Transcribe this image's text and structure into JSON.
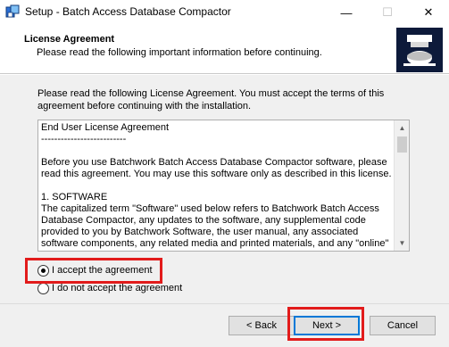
{
  "window": {
    "title": "Setup - Batch Access Database Compactor",
    "minimize": "—",
    "maximize": "☐",
    "close": "✕",
    "icon": "setup-app-icon"
  },
  "header": {
    "title": "License Agreement",
    "subtitle": "Please read the following important information before continuing.",
    "graphic": "database-compactor-graphic"
  },
  "main": {
    "intro": "Please read the following License Agreement. You must accept the terms of this agreement before continuing with the installation.",
    "license_text": "End User License Agreement\n--------------------------\n\nBefore you use Batchwork Batch Access Database Compactor software, please read this agreement. You may use this software only as described in this license.\n\n1. SOFTWARE\nThe capitalized term \"Software\" used below refers to Batchwork Batch Access Database Compactor, any updates to the software, any supplemental code provided to you by Batchwork Software, the user manual, any associated software components, any related media and printed materials, and any \"online\"",
    "scroll_up_icon": "▲",
    "scroll_down_icon": "▼",
    "accept_label": "I accept the agreement",
    "decline_label": "I do not accept the agreement",
    "accept_selected": true
  },
  "footer": {
    "back_label": "< Back",
    "next_label": "Next >",
    "cancel_label": "Cancel"
  },
  "colors": {
    "highlight": "#e21b1b",
    "default_button_border": "#0078d7",
    "dialog_background": "#f0f0f0",
    "header_graphic_bg": "#0d1a3a"
  }
}
